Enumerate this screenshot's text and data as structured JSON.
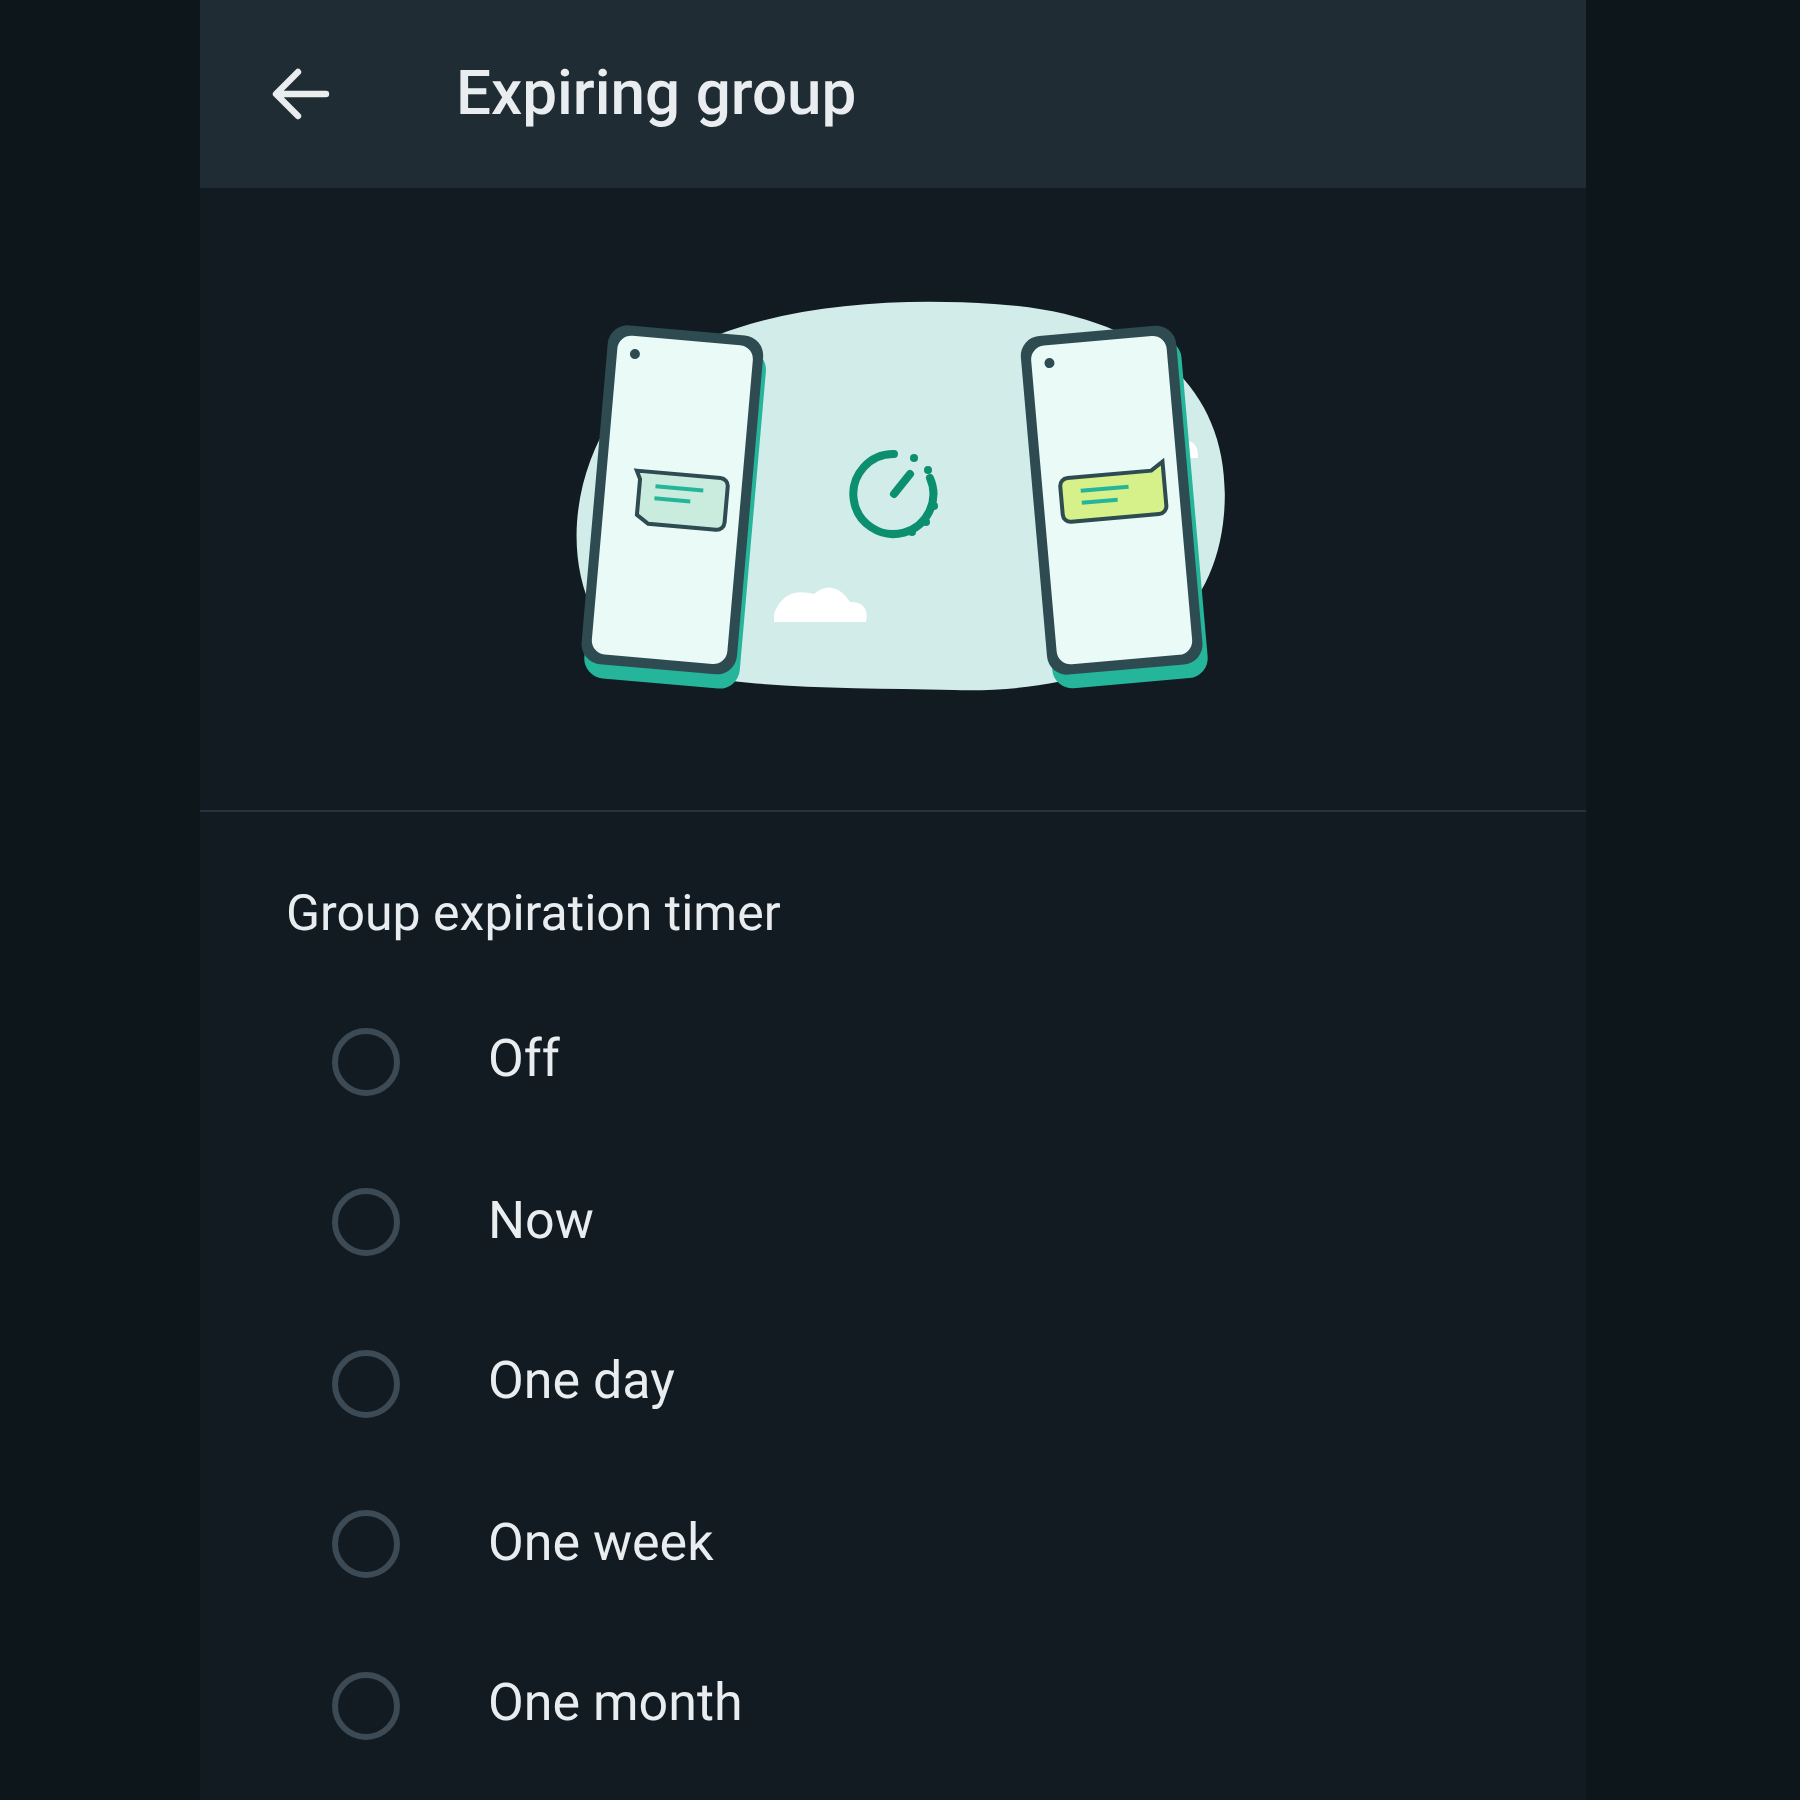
{
  "header": {
    "title": "Expiring group"
  },
  "section": {
    "heading": "Group expiration timer"
  },
  "options": [
    {
      "label": "Off",
      "selected": false
    },
    {
      "label": "Now",
      "selected": false
    },
    {
      "label": "One day",
      "selected": false
    },
    {
      "label": "One week",
      "selected": false
    },
    {
      "label": "One month",
      "selected": false
    }
  ]
}
